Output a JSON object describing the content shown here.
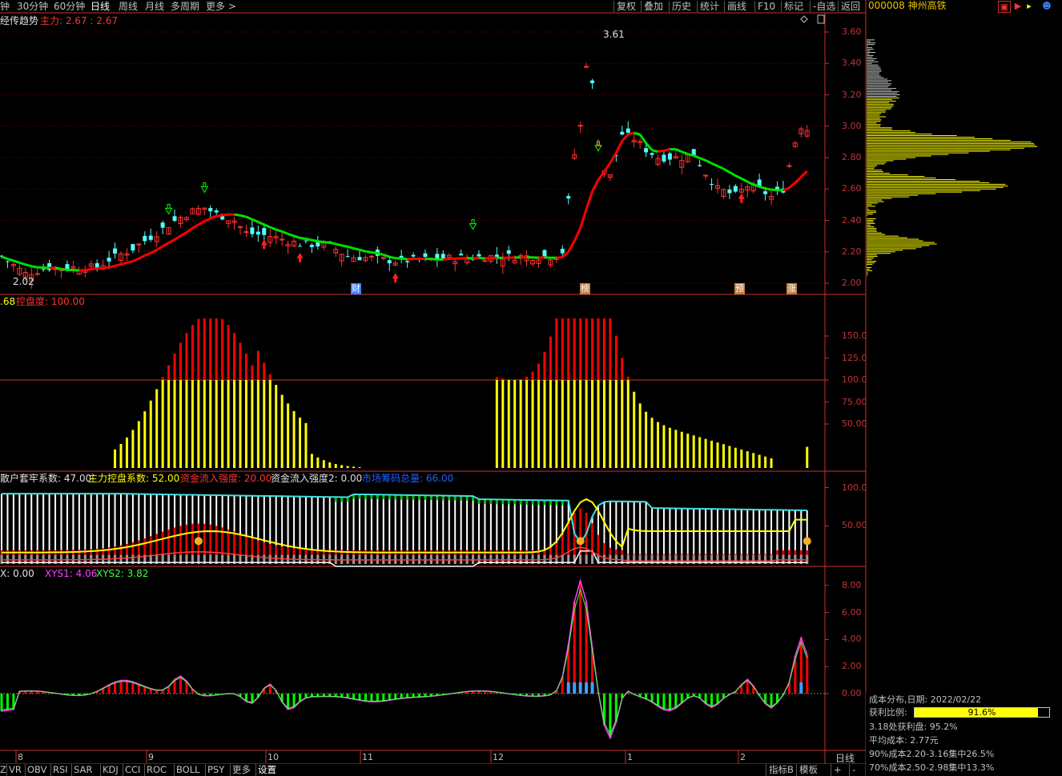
{
  "toolbar": {
    "items": [
      "钟",
      "30分钟",
      "60分钟",
      "日线",
      "周线",
      "月线",
      "多周期",
      "更多 >"
    ],
    "right_items": [
      "复权",
      "叠加",
      "历史",
      "统计",
      "画线",
      "F10",
      "标记",
      "-自选",
      "返回"
    ]
  },
  "stock": {
    "code_name": "000008 神州高铁"
  },
  "panel1": {
    "title": "经传趋势",
    "main_label": "主力: 2.67 : 2.67",
    "peak_label": "3.61",
    "low_label": "2.02",
    "y_ticks": [
      "3.60",
      "3.40",
      "3.20",
      "3.00",
      "2.80",
      "2.60",
      "2.40",
      "2.20",
      "2.00"
    ],
    "event_tags": [
      "财",
      "榜",
      "预",
      "涨"
    ]
  },
  "panel2": {
    "label_prefix": ".68",
    "label": "控盘度: 100.00",
    "y_ticks": [
      "150.0",
      "125.0",
      "100.0",
      "75.00",
      "50.00"
    ]
  },
  "panel3": {
    "labels": [
      {
        "text": "散户套牢系数: 47.00",
        "color": "#e0e0e0"
      },
      {
        "text": "主力控盘系数: 52.00",
        "color": "#ffff00"
      },
      {
        "text": "资金流入强度: 20.00",
        "color": "#ff3030"
      },
      {
        "text": "资金流入强度2: 0.00",
        "color": "#e0e0e0"
      },
      {
        "text": "市场筹码总量: 66.00",
        "color": "#2060ff"
      }
    ],
    "y_ticks": [
      "100.0",
      "50.00"
    ]
  },
  "panel4": {
    "labels": [
      {
        "text": "X: 0.00",
        "color": "#e0e0e0"
      },
      {
        "text": "XYS1: 4.06",
        "color": "#ff40ff"
      },
      {
        "text": "XYS2: 3.82",
        "color": "#40ff40"
      }
    ],
    "y_ticks": [
      "8.00",
      "6.00",
      "4.00",
      "2.00",
      "0.00"
    ]
  },
  "x_axis": {
    "ticks": [
      "8",
      "9",
      "10",
      "11",
      "12",
      "1",
      "2"
    ],
    "period": "日线"
  },
  "cost_distribution": {
    "date_line": "成本分布,日期: 2022/02/22",
    "profit_ratio_label": "获利比例:",
    "profit_ratio_value": "91.6%",
    "profit_ratio": 0.916,
    "profit_at": "3.18处获利盘: 95.2%",
    "avg_cost": "平均成本: 2.77元",
    "cost90": "90%成本2.20-3.16集中26.5%",
    "cost70": "70%成本2.50-2.98集中13.3%"
  },
  "bottom_tabs": {
    "items": [
      "Z",
      "VR",
      "OBV",
      "RSI",
      "SAR",
      "KDJ",
      "CCI",
      "ROC",
      "BOLL",
      "PSY",
      "更多",
      "设置"
    ],
    "right_items": [
      "指标B",
      "模板",
      "+",
      "-"
    ]
  },
  "colors": {
    "up": "#ff3232",
    "down": "#54fcfc",
    "ma_up": "#ff0000",
    "ma_down": "#00e000",
    "grid": "#7a0000",
    "axis": "#c83232",
    "yellow": "#ffff00"
  }
}
